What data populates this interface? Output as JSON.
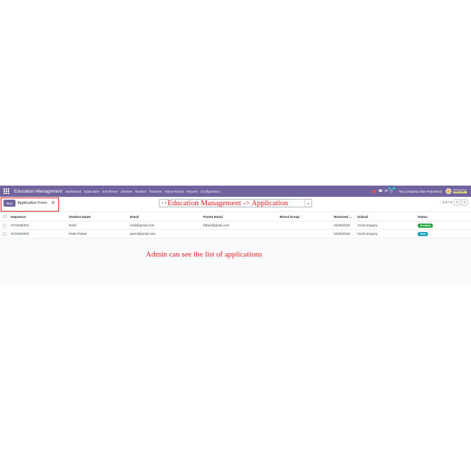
{
  "navbar": {
    "brand": "Education Management",
    "menu": [
      "Dashboard",
      "Application",
      "Enrollment",
      "Classes",
      "Student",
      "Teachers",
      "Notice-Board",
      "Reports",
      "Configuration"
    ],
    "company": "My Company (San Francisco)",
    "messages_count": "8",
    "activities_count": "14",
    "user": "Mitchell Admin",
    "database": "test_edu",
    "colors": {
      "bar": "#71639e"
    }
  },
  "control": {
    "new_label": "New",
    "title": "Application Form",
    "search_overlay": "Education Management -> Application",
    "pager": "1-2 / 2"
  },
  "table": {
    "headers": [
      "Sequence",
      "Student Name",
      "Email",
      "Parent Email",
      "Blood Group",
      "Received ...",
      "School",
      "Status"
    ],
    "rows": [
      {
        "sequence": "AF/2026/001",
        "student": "Rohit",
        "email": "rohit@gmail.com",
        "parent_email": "father@gmail.com",
        "blood_group": "",
        "received": "01/06/2026",
        "school": "YourCompany",
        "status": "Enrolled",
        "status_color": "#28a745"
      },
      {
        "sequence": "AF/2026/002",
        "student": "Peter Parker",
        "email": "peter@gmail.com",
        "parent_email": "",
        "blood_group": "",
        "received": "01/06/2026",
        "school": "YourCompany",
        "status": "New",
        "status_color": "#17a2b8"
      }
    ]
  },
  "annotation": "Admin can see the list of applications"
}
